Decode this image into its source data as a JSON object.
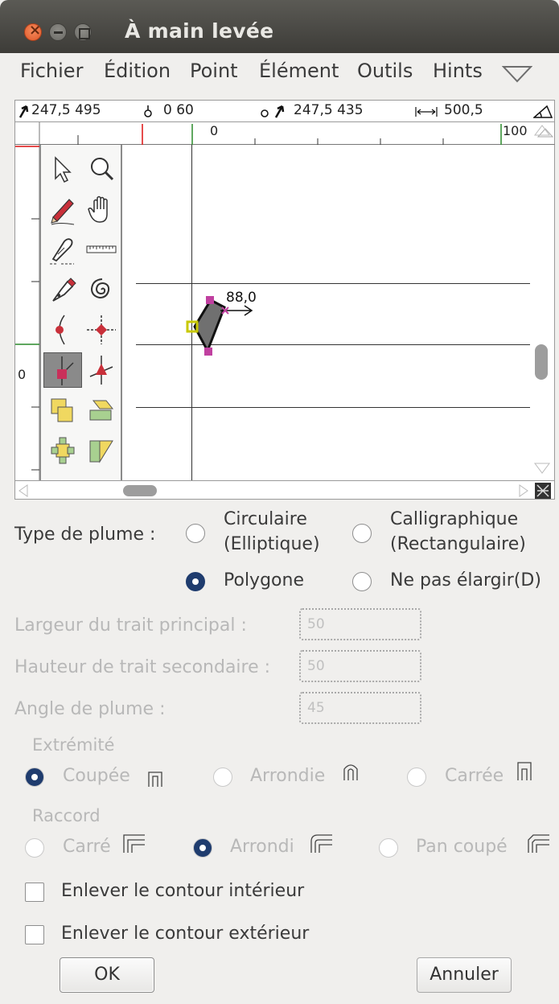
{
  "window": {
    "title": "À main levée"
  },
  "menu": {
    "items": [
      "Fichier",
      "Édition",
      "Point",
      "Élément",
      "Outils",
      "Hints"
    ]
  },
  "status": {
    "cursor": "247,5 495",
    "position": "0 60",
    "other": "247,5 435",
    "distance": "500,5",
    "ruler_zero": "0",
    "ruler_right": "100",
    "left_ruler_zero": "0"
  },
  "canvas": {
    "width_label": "88,0"
  },
  "tools": [
    "pointer-icon",
    "magnify-icon",
    "pencil-icon",
    "hand-icon",
    "knife-icon",
    "ruler-icon",
    "pen-icon",
    "spiral-icon",
    "curve-point-icon",
    "corner-point-icon",
    "box-point-icon",
    "tangent-point-icon",
    "rectangle-icon",
    "parallelogram-icon",
    "rotate-icon",
    "skew-icon"
  ],
  "form": {
    "pen_type_label": "Type  de plume :",
    "circular_line1": "Circulaire",
    "circular_line2": "(Elliptique)",
    "calligraphic_line1": "Calligraphique",
    "calligraphic_line2": "(Rectangulaire)",
    "polygon": "Polygone",
    "no_widen": "Ne pas élargir(D)",
    "main_width_label": "Largeur du trait principal :",
    "main_width_value": "50",
    "secondary_height_label": "Hauteur de trait secondaire :",
    "secondary_height_value": "50",
    "pen_angle_label": "Angle de plume :",
    "pen_angle_value": "45",
    "cap_label": "Extrémité",
    "cap_butt": "Coupée",
    "cap_round": "Arrondie",
    "cap_square": "Carrée",
    "join_label": "Raccord",
    "join_miter": "Carré",
    "join_round": "Arrondi",
    "join_bevel": "Pan coupé",
    "remove_inner": "Enlever le contour intérieur",
    "remove_outer": "Enlever le contour extérieur",
    "ok": "OK",
    "cancel": "Annuler"
  },
  "colors": {
    "selected_radio": "#1f3c6e",
    "titlebar": "#3d3c38"
  }
}
